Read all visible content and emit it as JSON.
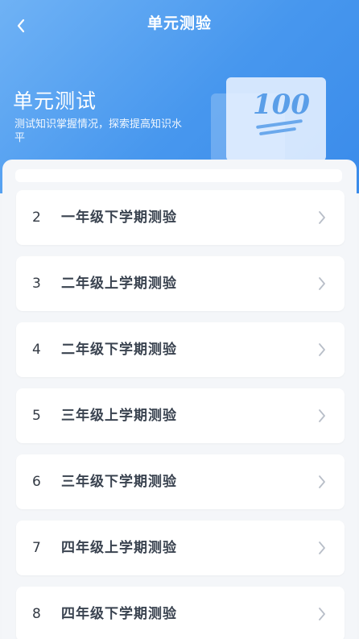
{
  "nav": {
    "title": "单元测验",
    "back_icon": "chevron-left-icon"
  },
  "hero": {
    "title": "单元测试",
    "subtitle": "测试知识掌握情况，探索提高知识水平",
    "badge_text": "100"
  },
  "colors": {
    "header_start": "#6fb2f5",
    "header_end": "#3a8bea",
    "label_text": "#3a4350",
    "chevron": "#b8bec8"
  },
  "list": {
    "items": [
      {
        "num": "2",
        "label": "一年级下学期测验"
      },
      {
        "num": "3",
        "label": "二年级上学期测验"
      },
      {
        "num": "4",
        "label": "二年级下学期测验"
      },
      {
        "num": "5",
        "label": "三年级上学期测验"
      },
      {
        "num": "6",
        "label": "三年级下学期测验"
      },
      {
        "num": "7",
        "label": "四年级上学期测验"
      },
      {
        "num": "8",
        "label": "四年级下学期测验"
      }
    ]
  }
}
